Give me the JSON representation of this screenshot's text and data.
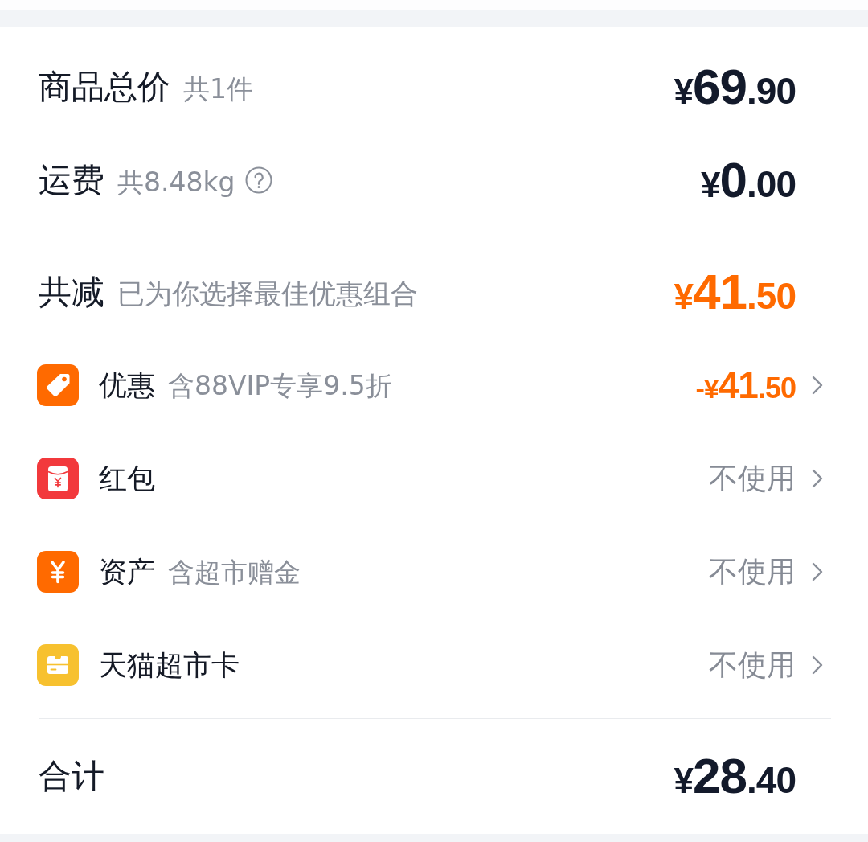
{
  "price_rows": [
    {
      "label": "商品总价",
      "note": "共1件",
      "help": false,
      "amount": "¥69.90"
    },
    {
      "label": "运费",
      "note": "共8.48kg",
      "help": true,
      "amount": "¥0.00"
    }
  ],
  "savings": {
    "label": "共减",
    "note": "已为你选择最佳优惠组合",
    "amount": "¥41.50"
  },
  "benefits": [
    {
      "kind": "coupon",
      "label": "优惠",
      "note": "含88VIP专享9.5折",
      "applied": true,
      "value": "-¥41.50"
    },
    {
      "kind": "red_packet",
      "label": "红包",
      "applied": false,
      "value": "不使用"
    },
    {
      "kind": "assets",
      "label": "资产",
      "note": "含超市赠金",
      "applied": false,
      "value": "不使用"
    },
    {
      "kind": "market_card",
      "label": "天猫超市卡",
      "applied": false,
      "value": "不使用"
    }
  ],
  "total": {
    "label": "合计",
    "amount": "¥28.40"
  }
}
